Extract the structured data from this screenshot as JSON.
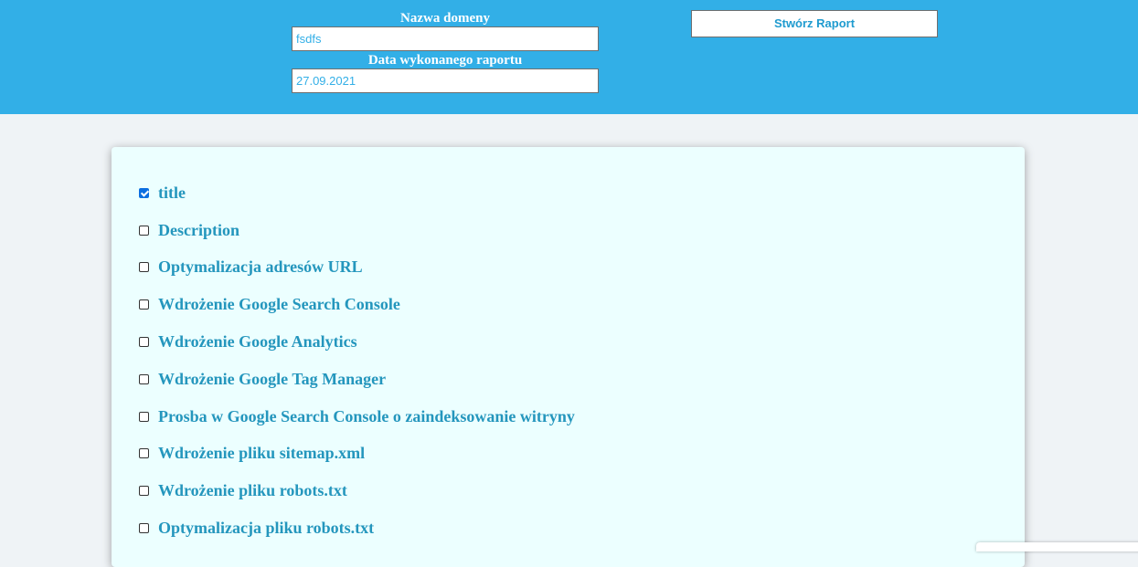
{
  "header": {
    "domain_label": "Nazwa domeny",
    "domain_value": "fsdfs",
    "date_label": "Data wykonanego raportu",
    "date_value": "27.09.2021",
    "create_button": "Stwórz Raport"
  },
  "checklist": {
    "items": [
      {
        "label": "title",
        "checked": true
      },
      {
        "label": "Description",
        "checked": false
      },
      {
        "label": "Optymalizacja adresów URL",
        "checked": false
      },
      {
        "label": "Wdrożenie Google Search Console",
        "checked": false
      },
      {
        "label": "Wdrożenie Google Analytics",
        "checked": false
      },
      {
        "label": "Wdrożenie Google Tag Manager",
        "checked": false
      },
      {
        "label": "Prosba w Google Search Console o zaindeksowanie witryny",
        "checked": false
      },
      {
        "label": "Wdrożenie pliku sitemap.xml",
        "checked": false
      },
      {
        "label": "Wdrożenie pliku robots.txt",
        "checked": false
      },
      {
        "label": "Optymalizacja pliku robots.txt",
        "checked": false
      }
    ]
  },
  "colors": {
    "header_bg": "#32afe7",
    "accent": "#2496bd",
    "card_bg": "#ecffff",
    "page_bg": "#eff3f6",
    "checkbox_checked": "#0b6ee0"
  }
}
